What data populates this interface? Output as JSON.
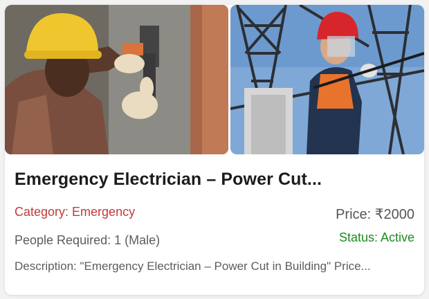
{
  "card": {
    "title": "Emergency Electrician – Power Cut...",
    "category": "Category: Emergency",
    "price": "Price: ₹2000",
    "people_required": "People Required: 1 (Male)",
    "status": "Status: Active",
    "description": "Description: \"Emergency Electrician – Power Cut in Building\" Price...",
    "colors": {
      "category": "#c33a3a",
      "status": "#1f8a1f",
      "title": "#1c1c1c"
    }
  }
}
